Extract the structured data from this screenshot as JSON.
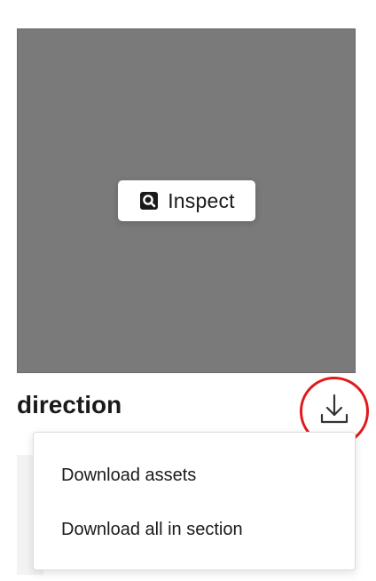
{
  "preview": {
    "background_color": "#7a7a7a",
    "inspect_button": {
      "label": "Inspect",
      "icon": "inspect-icon"
    }
  },
  "asset": {
    "title": "direction"
  },
  "download": {
    "icon": "download-icon",
    "highlight_color": "#e0191a"
  },
  "menu": {
    "items": [
      {
        "label": "Download assets"
      },
      {
        "label": "Download all in section"
      }
    ]
  }
}
